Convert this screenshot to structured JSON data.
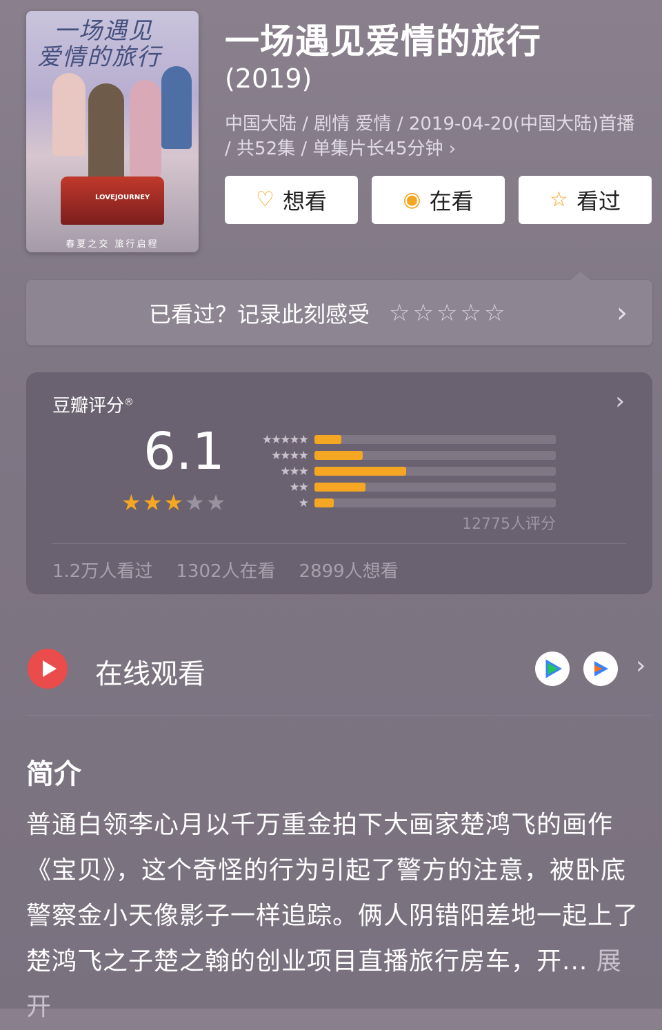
{
  "movie": {
    "title": "一场遇见爱情的旅行",
    "year": "(2019)",
    "meta": "中国大陆 / 剧情 爱情 / 2019-04-20(中国大陆)首播 / 共52集 / 单集片长45分钟 ›",
    "poster": {
      "title_line1": "一场遇见",
      "title_line2": "爱情的旅行",
      "tag": "LOVEJOURNEY",
      "bottom_text": "春夏之交 旅行启程"
    }
  },
  "actions": [
    {
      "label": "想看",
      "icon": "heart-plus-icon",
      "glyph": "♡"
    },
    {
      "label": "在看",
      "icon": "target-icon",
      "glyph": "◉"
    },
    {
      "label": "看过",
      "icon": "star-outline-icon",
      "glyph": "☆"
    }
  ],
  "record": {
    "text": "已看过？记录此刻感受",
    "stars": "☆☆☆☆☆"
  },
  "rating": {
    "label": "豆瓣评分",
    "mark": "®",
    "score": "6.1",
    "stars_on": "★★★",
    "stars_off": "★★",
    "distribution": [
      {
        "stars": "★★★★★",
        "fraction": 0.11
      },
      {
        "stars": "★★★★",
        "fraction": 0.2
      },
      {
        "stars": "★★★",
        "fraction": 0.38
      },
      {
        "stars": "★★",
        "fraction": 0.21
      },
      {
        "stars": "★",
        "fraction": 0.08
      }
    ],
    "count": "12775人评分",
    "stats": [
      "1.2万人看过",
      "1302人在看",
      "2899人想看"
    ],
    "colors": {
      "fill": "#f5a623"
    }
  },
  "online": {
    "label": "在线观看",
    "apps": [
      "iqiyi-play-icon",
      "tencent-video-icon"
    ]
  },
  "intro": {
    "heading": "简介",
    "text": "普通白领李心月以千万重金拍下大画家楚鸿飞的画作《宝贝》，这个奇怪的行为引起了警方的注意，被卧底警察金小天像影子一样追踪。俩人阴错阳差地一起上了楚鸿飞之子楚之翰的创业项目直播旅行房车，开...",
    "more": "展开"
  }
}
